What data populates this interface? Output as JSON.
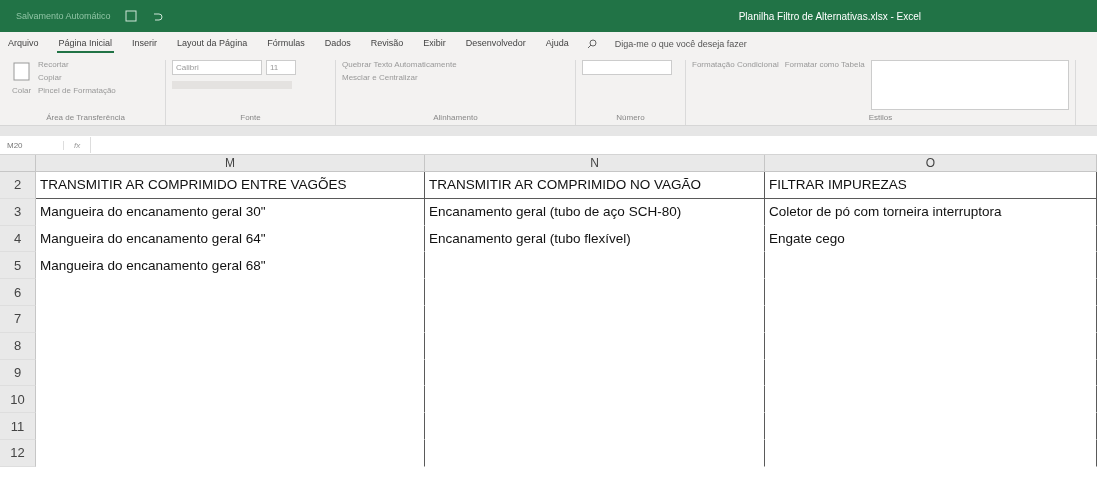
{
  "title_bar": {
    "autosave": "Salvamento Automático",
    "title": "Planilha Filtro de Alternativas.xlsx - Excel"
  },
  "tabs": [
    {
      "label": "Arquivo",
      "selected": false
    },
    {
      "label": "Página Inicial",
      "selected": true
    },
    {
      "label": "Inserir",
      "selected": false
    },
    {
      "label": "Layout da Página",
      "selected": false
    },
    {
      "label": "Fórmulas",
      "selected": false
    },
    {
      "label": "Dados",
      "selected": false
    },
    {
      "label": "Revisão",
      "selected": false
    },
    {
      "label": "Exibir",
      "selected": false
    },
    {
      "label": "Desenvolvedor",
      "selected": false
    },
    {
      "label": "Ajuda",
      "selected": false
    }
  ],
  "tell_me": {
    "placeholder": "Diga-me o que você deseja fazer"
  },
  "ribbon": {
    "clipboard": {
      "paste": "Colar",
      "cut": "Recortar",
      "copy": "Copiar",
      "format_painter": "Pincel de Formatação",
      "label": "Área de Transferência"
    },
    "font": {
      "name": "Calibri",
      "size": "11",
      "label": "Fonte"
    },
    "alignment": {
      "wrap": "Quebrar Texto Automaticamente",
      "merge": "Mesclar e Centralizar",
      "label": "Alinhamento"
    },
    "number": {
      "label": "Número"
    },
    "styles": {
      "conditional": "Formatação Condicional",
      "table": "Formatar como Tabela",
      "label": "Estilos"
    }
  },
  "formula_bar": {
    "name_box": "M20",
    "fx": "fx"
  },
  "sheet": {
    "columns": [
      "M",
      "N",
      "O"
    ],
    "rows": [
      {
        "number": "2",
        "header": true,
        "cells": [
          "TRANSMITIR AR COMPRIMIDO ENTRE VAGÕES",
          "TRANSMITIR AR COMPRIMIDO NO VAGÃO",
          "FILTRAR IMPUREZAS"
        ]
      },
      {
        "number": "3",
        "header": false,
        "cells": [
          "Mangueira do encanamento geral 30\"",
          "Encanamento geral (tubo de aço SCH-80)",
          "Coletor de pó com torneira interruptora"
        ]
      },
      {
        "number": "4",
        "header": false,
        "cells": [
          "Mangueira do encanamento geral 64\"",
          "Encanamento geral (tubo flexível)",
          "Engate cego"
        ]
      },
      {
        "number": "5",
        "header": false,
        "cells": [
          "Mangueira do encanamento geral 68\"",
          "",
          ""
        ]
      },
      {
        "number": "6",
        "header": false,
        "cells": [
          "",
          "",
          ""
        ]
      },
      {
        "number": "7",
        "header": false,
        "cells": [
          "",
          "",
          ""
        ]
      },
      {
        "number": "8",
        "header": false,
        "cells": [
          "",
          "",
          ""
        ]
      },
      {
        "number": "9",
        "header": false,
        "cells": [
          "",
          "",
          ""
        ]
      },
      {
        "number": "10",
        "header": false,
        "cells": [
          "",
          "",
          ""
        ]
      },
      {
        "number": "11",
        "header": false,
        "cells": [
          "",
          "",
          ""
        ]
      },
      {
        "number": "12",
        "header": false,
        "cells": [
          "",
          "",
          ""
        ]
      }
    ]
  }
}
